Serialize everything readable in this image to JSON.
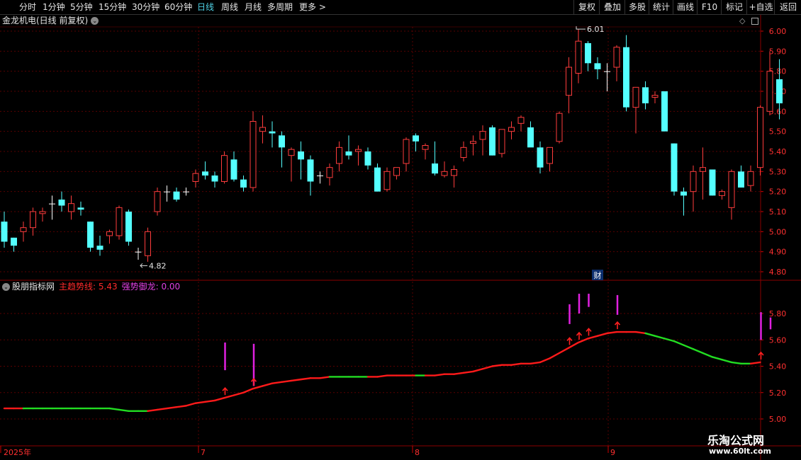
{
  "toolbar": {
    "periods": [
      {
        "label": "分时",
        "active": false
      },
      {
        "label": "1分钟",
        "active": false
      },
      {
        "label": "5分钟",
        "active": false
      },
      {
        "label": "15分钟",
        "active": false
      },
      {
        "label": "30分钟",
        "active": false
      },
      {
        "label": "60分钟",
        "active": false
      },
      {
        "label": "日线",
        "active": true
      },
      {
        "label": "周线",
        "active": false
      },
      {
        "label": "月线",
        "active": false
      },
      {
        "label": "多周期",
        "active": false
      },
      {
        "label": "更多 >",
        "active": false
      }
    ],
    "right_buttons": [
      "复权",
      "叠加",
      "多股",
      "统计",
      "画线",
      "F10",
      "标记",
      "+自选",
      "返回"
    ]
  },
  "stock": {
    "title": "金龙机电(日线 前复权)",
    "high_label": "6.01",
    "low_label": "4.82",
    "finance_badge": "财"
  },
  "indicator": {
    "name": "股朋指标网",
    "main_label": "主趋势线: 5.43",
    "strong_label": "强势御龙: 0.00"
  },
  "axis": {
    "main_ticks": [
      "6.00",
      "5.90",
      "5.80",
      "5.70",
      "5.60",
      "5.50",
      "5.40",
      "5.30",
      "5.20",
      "5.10",
      "5.00",
      "4.90",
      "4.80"
    ],
    "sub_ticks": [
      "5.80",
      "5.60",
      "5.40",
      "5.20",
      "5.00"
    ],
    "dates": [
      "2025年",
      "7",
      "8",
      "9"
    ]
  },
  "colors": {
    "up": "#ff3c3c",
    "down": "#54ffff",
    "grid": "#5a0000",
    "line_up": "#ff1a1a",
    "line_down": "#22dd22",
    "signal": "#e020e0",
    "arrow": "#ff2020"
  },
  "watermark": {
    "line1": "乐淘公式网",
    "line2": "www.60lt.com"
  },
  "chart_data": {
    "type": "candlestick",
    "main_ylim": [
      4.77,
      6.03
    ],
    "candles": [
      [
        5.05,
        5.1,
        4.92,
        4.95
      ],
      [
        4.97,
        4.97,
        4.9,
        4.93
      ],
      [
        5.0,
        5.05,
        4.95,
        5.02
      ],
      [
        5.02,
        5.12,
        4.98,
        5.1
      ],
      [
        5.09,
        5.12,
        5.05,
        5.1
      ],
      [
        5.14,
        5.18,
        5.06,
        5.14
      ],
      [
        5.16,
        5.2,
        5.1,
        5.13
      ],
      [
        5.1,
        5.18,
        5.06,
        5.14
      ],
      [
        5.12,
        5.15,
        5.08,
        5.11
      ],
      [
        5.05,
        5.05,
        4.9,
        4.92
      ],
      [
        4.93,
        4.98,
        4.88,
        4.91
      ],
      [
        4.98,
        5.01,
        4.94,
        5.0
      ],
      [
        4.98,
        5.13,
        4.96,
        5.12
      ],
      [
        5.1,
        5.11,
        4.93,
        4.95
      ],
      [
        4.9,
        4.92,
        4.86,
        4.9
      ],
      [
        4.88,
        5.02,
        4.85,
        5.0
      ],
      [
        5.1,
        5.22,
        5.08,
        5.2
      ],
      [
        5.2,
        5.23,
        5.15,
        5.2
      ],
      [
        5.2,
        5.22,
        5.15,
        5.16
      ],
      [
        5.2,
        5.22,
        5.18,
        5.2
      ],
      [
        5.25,
        5.31,
        5.22,
        5.29
      ],
      [
        5.3,
        5.35,
        5.26,
        5.28
      ],
      [
        5.28,
        5.3,
        5.22,
        5.25
      ],
      [
        5.25,
        5.4,
        5.24,
        5.38
      ],
      [
        5.36,
        5.4,
        5.25,
        5.26
      ],
      [
        5.26,
        5.28,
        5.2,
        5.22
      ],
      [
        5.22,
        5.6,
        5.2,
        5.55
      ],
      [
        5.5,
        5.58,
        5.44,
        5.52
      ],
      [
        5.5,
        5.55,
        5.42,
        5.49
      ],
      [
        5.48,
        5.5,
        5.32,
        5.42
      ],
      [
        5.38,
        5.42,
        5.25,
        5.41
      ],
      [
        5.4,
        5.45,
        5.26,
        5.36
      ],
      [
        5.36,
        5.38,
        5.18,
        5.25
      ],
      [
        5.28,
        5.3,
        5.24,
        5.28
      ],
      [
        5.27,
        5.34,
        5.23,
        5.32
      ],
      [
        5.34,
        5.45,
        5.3,
        5.42
      ],
      [
        5.4,
        5.48,
        5.36,
        5.38
      ],
      [
        5.4,
        5.43,
        5.33,
        5.41
      ],
      [
        5.4,
        5.42,
        5.31,
        5.33
      ],
      [
        5.32,
        5.34,
        5.2,
        5.2
      ],
      [
        5.21,
        5.32,
        5.2,
        5.3
      ],
      [
        5.28,
        5.32,
        5.26,
        5.32
      ],
      [
        5.34,
        5.47,
        5.3,
        5.46
      ],
      [
        5.48,
        5.49,
        5.4,
        5.45
      ],
      [
        5.41,
        5.44,
        5.36,
        5.43
      ],
      [
        5.34,
        5.45,
        5.28,
        5.29
      ],
      [
        5.28,
        5.35,
        5.27,
        5.3
      ],
      [
        5.28,
        5.33,
        5.22,
        5.31
      ],
      [
        5.37,
        5.45,
        5.35,
        5.42
      ],
      [
        5.44,
        5.48,
        5.38,
        5.45
      ],
      [
        5.46,
        5.53,
        5.38,
        5.5
      ],
      [
        5.52,
        5.53,
        5.38,
        5.38
      ],
      [
        5.39,
        5.51,
        5.37,
        5.51
      ],
      [
        5.5,
        5.55,
        5.46,
        5.52
      ],
      [
        5.54,
        5.58,
        5.5,
        5.57
      ],
      [
        5.52,
        5.55,
        5.43,
        5.42
      ],
      [
        5.42,
        5.45,
        5.29,
        5.32
      ],
      [
        5.34,
        5.42,
        5.3,
        5.42
      ],
      [
        5.45,
        5.6,
        5.44,
        5.59
      ],
      [
        5.68,
        5.87,
        5.59,
        5.82
      ],
      [
        5.79,
        6.01,
        5.74,
        5.95
      ],
      [
        5.94,
        5.95,
        5.8,
        5.84
      ],
      [
        5.84,
        5.87,
        5.76,
        5.81
      ],
      [
        5.8,
        5.84,
        5.7,
        5.8
      ],
      [
        5.82,
        5.93,
        5.75,
        5.92
      ],
      [
        5.92,
        5.98,
        5.6,
        5.62
      ],
      [
        5.62,
        5.72,
        5.49,
        5.72
      ],
      [
        5.72,
        5.75,
        5.61,
        5.64
      ],
      [
        5.67,
        5.7,
        5.64,
        5.68
      ],
      [
        5.7,
        5.7,
        5.5,
        5.5
      ],
      [
        5.44,
        5.44,
        5.18,
        5.2
      ],
      [
        5.2,
        5.22,
        5.08,
        5.18
      ],
      [
        5.2,
        5.33,
        5.1,
        5.3
      ],
      [
        5.3,
        5.42,
        5.16,
        5.32
      ],
      [
        5.31,
        5.31,
        5.18,
        5.18
      ],
      [
        5.18,
        5.21,
        5.16,
        5.2
      ],
      [
        5.12,
        5.31,
        5.06,
        5.3
      ],
      [
        5.3,
        5.33,
        5.22,
        5.22
      ],
      [
        5.23,
        5.33,
        5.2,
        5.3
      ],
      [
        5.32,
        5.63,
        5.28,
        5.62
      ],
      [
        5.6,
        5.9,
        5.58,
        5.8
      ],
      [
        5.76,
        5.86,
        5.56,
        5.64
      ]
    ],
    "sub_ylim": [
      4.95,
      5.99
    ],
    "trend_line": [
      5.08,
      5.08,
      5.08,
      5.08,
      5.08,
      5.08,
      5.08,
      5.08,
      5.08,
      5.08,
      5.08,
      5.08,
      5.07,
      5.06,
      5.06,
      5.06,
      5.07,
      5.08,
      5.09,
      5.1,
      5.12,
      5.13,
      5.14,
      5.16,
      5.18,
      5.2,
      5.23,
      5.25,
      5.27,
      5.28,
      5.29,
      5.3,
      5.31,
      5.31,
      5.32,
      5.32,
      5.32,
      5.32,
      5.32,
      5.32,
      5.33,
      5.33,
      5.33,
      5.33,
      5.33,
      5.33,
      5.34,
      5.34,
      5.35,
      5.36,
      5.38,
      5.4,
      5.41,
      5.41,
      5.42,
      5.42,
      5.43,
      5.46,
      5.5,
      5.54,
      5.58,
      5.61,
      5.63,
      5.65,
      5.66,
      5.66,
      5.66,
      5.65,
      5.63,
      5.61,
      5.59,
      5.56,
      5.53,
      5.5,
      5.47,
      5.45,
      5.43,
      5.42,
      5.42,
      5.43
    ],
    "trend_dir": [
      "u",
      "u",
      "d",
      "d",
      "d",
      "d",
      "d",
      "d",
      "d",
      "d",
      "d",
      "d",
      "d",
      "d",
      "d",
      "u",
      "u",
      "u",
      "u",
      "u",
      "u",
      "u",
      "u",
      "u",
      "u",
      "u",
      "u",
      "u",
      "u",
      "u",
      "u",
      "u",
      "u",
      "u",
      "d",
      "d",
      "d",
      "d",
      "u",
      "u",
      "u",
      "u",
      "u",
      "d",
      "u",
      "u",
      "u",
      "u",
      "u",
      "u",
      "u",
      "u",
      "u",
      "u",
      "u",
      "u",
      "u",
      "u",
      "u",
      "u",
      "u",
      "u",
      "u",
      "u",
      "u",
      "u",
      "u",
      "d",
      "d",
      "d",
      "d",
      "d",
      "d",
      "d",
      "d",
      "d",
      "d",
      "d",
      "u",
      "u"
    ],
    "signals": [
      {
        "i": 23,
        "y1": 5.37,
        "y2": 5.58
      },
      {
        "i": 26,
        "y1": 5.25,
        "y2": 5.57
      },
      {
        "i": 59,
        "y1": 5.72,
        "y2": 5.87
      },
      {
        "i": 60,
        "y1": 5.8,
        "y2": 5.95
      },
      {
        "i": 61,
        "y1": 5.85,
        "y2": 5.95
      },
      {
        "i": 64,
        "y1": 5.79,
        "y2": 5.94
      },
      {
        "i": 79,
        "y1": 5.6,
        "y2": 5.81
      },
      {
        "i": 80,
        "y1": 5.68,
        "y2": 5.77
      }
    ],
    "arrows": [
      23,
      26,
      59,
      60,
      61,
      64,
      79,
      80
    ]
  }
}
